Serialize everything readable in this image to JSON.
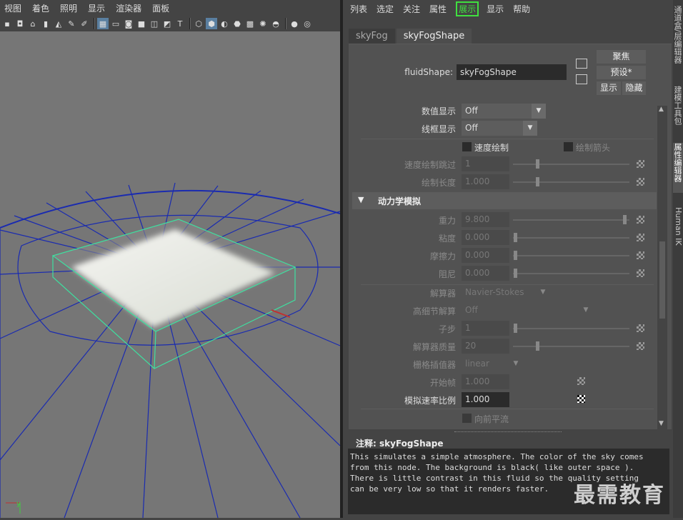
{
  "viewport": {
    "menu": [
      "视图",
      "着色",
      "照明",
      "显示",
      "渲染器",
      "面板"
    ],
    "axis_label": "y"
  },
  "attribute_editor": {
    "menu": [
      "列表",
      "选定",
      "关注",
      "属性",
      "展示",
      "显示",
      "帮助"
    ],
    "tabs": [
      "skyFog",
      "skyFogShape"
    ],
    "fluid_shape_label": "fluidShape:",
    "fluid_shape_value": "skyFogShape",
    "buttons": {
      "focus": "聚焦",
      "preset": "预设*",
      "show": "显示",
      "hide": "隐藏"
    },
    "value_display": {
      "label": "数值显示",
      "value": "Off"
    },
    "wireframe_display": {
      "label": "线框显示",
      "value": "Off"
    },
    "velocity_draw": "速度绘制",
    "draw_arrows": "绘制箭头",
    "velocity_draw_skip": {
      "label": "速度绘制跳过",
      "value": "1"
    },
    "draw_length": {
      "label": "绘制长度",
      "value": "1.000"
    },
    "section": "动力学模拟",
    "gravity": {
      "label": "重力",
      "value": "9.800"
    },
    "viscosity": {
      "label": "粘度",
      "value": "0.000"
    },
    "friction": {
      "label": "摩擦力",
      "value": "0.000"
    },
    "damp": {
      "label": "阻尼",
      "value": "0.000"
    },
    "solver": {
      "label": "解算器",
      "value": "Navier-Stokes"
    },
    "high_detail_solve": {
      "label": "高细节解算",
      "value": "Off"
    },
    "substeps": {
      "label": "子步",
      "value": "1"
    },
    "solver_quality": {
      "label": "解算器质量",
      "value": "20"
    },
    "grid_interpolator": {
      "label": "栅格插值器",
      "value": "linear"
    },
    "start_frame": {
      "label": "开始帧",
      "value": "1.000"
    },
    "simulation_rate_scale": {
      "label": "模拟速率比例",
      "value": "1.000"
    },
    "forward_advection": "向前平流",
    "notes_label": "注释:",
    "notes_node": "skyFogShape",
    "notes_text": "This simulates a simple atmosphere. The color of the sky comes\nfrom this node. The background is black( like outer space ).\nThere is little contrast in this fluid so the quality setting\ncan be very low so that it renders faster."
  },
  "side_tabs": [
    "通道盒/层编辑器",
    "建模工具包",
    "属性编辑器",
    "Human IK"
  ],
  "watermark": "最需教育",
  "colors": {
    "highlight": "#3fe03f",
    "wireframe": "#1a2bb0",
    "bbox": "#3ee0a0",
    "field_bg": "#2b2b2b"
  }
}
